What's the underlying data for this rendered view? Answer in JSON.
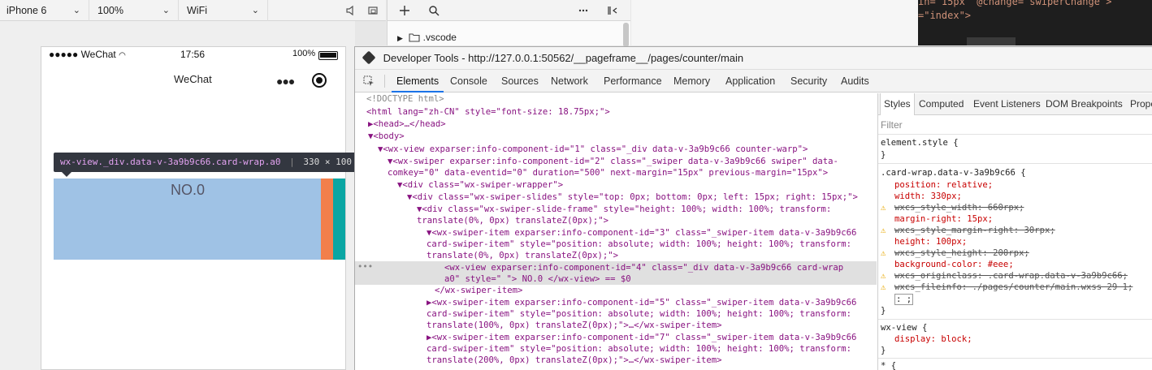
{
  "sim_toolbar": {
    "device": "iPhone 6",
    "zoom": "100%",
    "network": "WiFi"
  },
  "file_tree": {
    "folder": ".vscode"
  },
  "editor": {
    "line1": "in= 15px  @change= swiperChange >",
    "line2": "=\"index\">"
  },
  "phone": {
    "carrier": "●●●●● WeChat",
    "time": "17:56",
    "battery": "100%",
    "nav_title": "WeChat",
    "tooltip_selector": "wx-view._div.data-v-3a9b9c66.card-wrap.a0",
    "tooltip_size": "330 × 100",
    "card_label": "NO.0",
    "slide_colors": [
      "#9fc2e5",
      "#f27f4b",
      "#0aa6a3"
    ]
  },
  "devtools": {
    "title": "Developer Tools - http://127.0.0.1:50562/__pageframe__/pages/counter/main",
    "tabs": [
      "Elements",
      "Console",
      "Sources",
      "Network",
      "Performance",
      "Memory",
      "Application",
      "Security",
      "Audits"
    ],
    "active_tab": "Elements",
    "dom_lines": [
      "<!DOCTYPE html>",
      "<html lang=\"zh-CN\" style=\"font-size: 18.75px;\">",
      "▶<head>…</head>",
      "▼<body>",
      "▼<wx-view exparser:info-component-id=\"1\" class=\"_div data-v-3a9b9c66 counter-warp\">",
      "▼<wx-swiper exparser:info-component-id=\"2\" class=\"_swiper data-v-3a9b9c66 swiper\" data-",
      "comkey=\"0\" data-eventid=\"0\" duration=\"500\" next-margin=\"15px\" previous-margin=\"15px\">",
      "▼<div class=\"wx-swiper-wrapper\">",
      "▼<div class=\"wx-swiper-slides\" style=\"top: 0px; bottom: 0px; left: 15px; right: 15px;\">",
      "▼<div class=\"wx-swiper-slide-frame\" style=\"height: 100%; width: 100%; transform:",
      "translate(0%, 0px) translateZ(0px);\">",
      "▼<wx-swiper-item exparser:info-component-id=\"3\" class=\"_swiper-item data-v-3a9b9c66",
      "card-swiper-item\" style=\"position: absolute; width: 100%; height: 100%; transform:",
      "translate(0%, 0px) translateZ(0px);\">",
      "<wx-view exparser:info-component-id=\"4\" class=\"_div data-v-3a9b9c66 card-wrap",
      "a0\" style=\" \"> NO.0 </wx-view> == $0",
      "</wx-swiper-item>",
      "▶<wx-swiper-item exparser:info-component-id=\"5\" class=\"_swiper-item data-v-3a9b9c66",
      "card-swiper-item\" style=\"position: absolute; width: 100%; height: 100%; transform:",
      "translate(100%, 0px) translateZ(0px);\">…</wx-swiper-item>",
      "▶<wx-swiper-item exparser:info-component-id=\"7\" class=\"_swiper-item data-v-3a9b9c66",
      "card-swiper-item\" style=\"position: absolute; width: 100%; height: 100%; transform:",
      "translate(200%, 0px) translateZ(0px);\">…</wx-swiper-item>"
    ],
    "ellipsis": "•••",
    "styles_tabs": [
      "Styles",
      "Computed",
      "Event Listeners",
      "DOM Breakpoints",
      "Prope"
    ],
    "filter_placeholder": "Filter",
    "style_lines": [
      "element.style {",
      "}",
      ".card-wrap.data-v-3a9b9c66 {",
      "position: relative;",
      "width: 330px;",
      "wxcs_style_width: 660rpx;",
      "margin-right: 15px;",
      "wxcs_style_margin-right: 30rpx;",
      "height: 100px;",
      "wxcs_style_height: 200rpx;",
      "background-color: #eee;",
      "wxcs_originclass: .card-wrap.data-v-3a9b9c66;",
      "wxcs_fileinfo: ./pages/counter/main.wxss 29 1;",
      ": ;",
      "}",
      "wx-view {",
      "display: block;",
      "}",
      "* {"
    ]
  }
}
